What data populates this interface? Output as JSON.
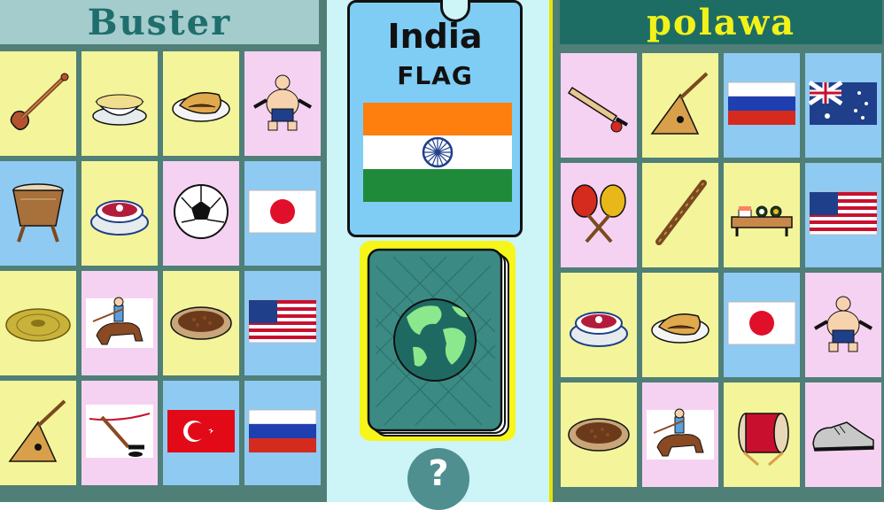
{
  "players": {
    "left": {
      "name": "Buster"
    },
    "right": {
      "name": "polawa"
    }
  },
  "center": {
    "country": "India",
    "category": "FLAG",
    "help_label": "?"
  },
  "colors": {
    "saffron": "#ff7f0e",
    "india_green": "#1f8a3a",
    "chakra_blue": "#1f3f8a",
    "highlight": "#f6f61a"
  },
  "left_cards": [
    {
      "item": "sitar",
      "bg": "y"
    },
    {
      "item": "rice-bowl",
      "bg": "y"
    },
    {
      "item": "meat-pie",
      "bg": "y"
    },
    {
      "item": "sumo-wrestler",
      "bg": "p"
    },
    {
      "item": "djembe-drum",
      "bg": "b"
    },
    {
      "item": "borscht",
      "bg": "y"
    },
    {
      "item": "soccer-ball",
      "bg": "p"
    },
    {
      "item": "flag-japan",
      "bg": "b"
    },
    {
      "item": "cymbal",
      "bg": "y"
    },
    {
      "item": "polo-rider",
      "bg": "p"
    },
    {
      "item": "chili-bowl",
      "bg": "y"
    },
    {
      "item": "flag-usa",
      "bg": "b"
    },
    {
      "item": "balalaika",
      "bg": "y"
    },
    {
      "item": "ice-hockey",
      "bg": "p"
    },
    {
      "item": "flag-turkey",
      "bg": "b"
    },
    {
      "item": "flag-russia",
      "bg": "b"
    }
  ],
  "right_cards": [
    {
      "item": "cricket-bat",
      "bg": "p"
    },
    {
      "item": "balalaika",
      "bg": "y"
    },
    {
      "item": "flag-russia",
      "bg": "b"
    },
    {
      "item": "flag-australia",
      "bg": "b"
    },
    {
      "item": "maracas",
      "bg": "p"
    },
    {
      "item": "didgeridoo",
      "bg": "y"
    },
    {
      "item": "sushi-tray",
      "bg": "y"
    },
    {
      "item": "flag-usa",
      "bg": "b"
    },
    {
      "item": "borscht",
      "bg": "y"
    },
    {
      "item": "meat-pie",
      "bg": "y"
    },
    {
      "item": "flag-japan",
      "bg": "b"
    },
    {
      "item": "sumo-wrestler",
      "bg": "p"
    },
    {
      "item": "chili-bowl",
      "bg": "y"
    },
    {
      "item": "polo-rider",
      "bg": "p"
    },
    {
      "item": "taiko-drum",
      "bg": "y"
    },
    {
      "item": "running-shoe",
      "bg": "p"
    }
  ]
}
